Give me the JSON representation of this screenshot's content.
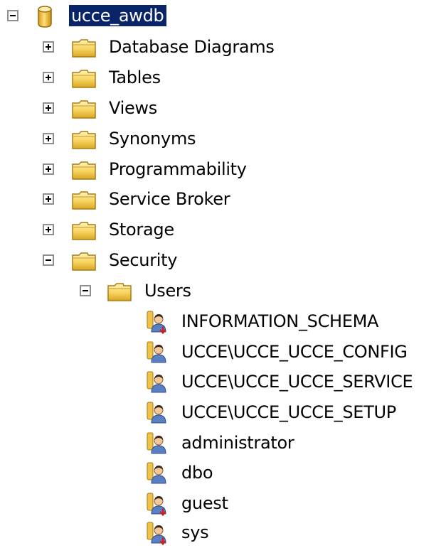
{
  "tree": {
    "database": {
      "label": "ucce_awdb",
      "icon": "database-icon",
      "state": "expanded",
      "selected": true
    },
    "folders": [
      {
        "label": "Database Diagrams",
        "icon": "folder-icon",
        "state": "collapsed"
      },
      {
        "label": "Tables",
        "icon": "folder-icon",
        "state": "collapsed"
      },
      {
        "label": "Views",
        "icon": "folder-icon",
        "state": "collapsed"
      },
      {
        "label": "Synonyms",
        "icon": "folder-icon",
        "state": "collapsed"
      },
      {
        "label": "Programmability",
        "icon": "folder-icon",
        "state": "collapsed"
      },
      {
        "label": "Service Broker",
        "icon": "folder-icon",
        "state": "collapsed"
      },
      {
        "label": "Storage",
        "icon": "folder-icon",
        "state": "collapsed"
      },
      {
        "label": "Security",
        "icon": "folder-icon",
        "state": "expanded"
      }
    ],
    "security": {
      "users_folder": {
        "label": "Users",
        "icon": "folder-icon",
        "state": "expanded"
      },
      "users": [
        {
          "label": "INFORMATION_SCHEMA",
          "icon": "disabled-user-icon"
        },
        {
          "label": "UCCE\\UCCE_UCCE_CONFIG",
          "icon": "user-icon"
        },
        {
          "label": "UCCE\\UCCE_UCCE_SERVICE",
          "icon": "user-icon"
        },
        {
          "label": "UCCE\\UCCE_UCCE_SETUP",
          "icon": "user-icon"
        },
        {
          "label": "administrator",
          "icon": "user-icon"
        },
        {
          "label": "dbo",
          "icon": "user-icon"
        },
        {
          "label": "guest",
          "icon": "disabled-user-icon"
        },
        {
          "label": "sys",
          "icon": "disabled-user-icon"
        }
      ]
    }
  },
  "colors": {
    "selection_background": "#0a246a",
    "selection_text": "#ffffff",
    "folder_yellow": "#f6d35e",
    "expander_border": "#8f8f8f"
  }
}
